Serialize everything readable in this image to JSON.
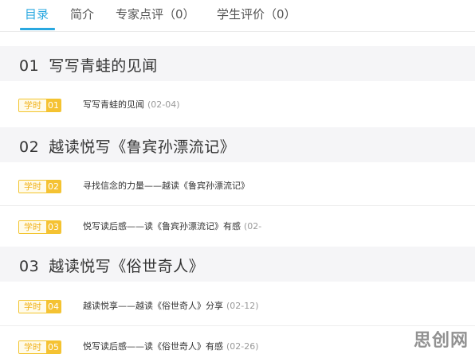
{
  "tabs": [
    {
      "label": "目录",
      "active": true
    },
    {
      "label": "简介"
    },
    {
      "label": "专家点评（0）"
    },
    {
      "label": "学生评价（0）"
    }
  ],
  "sections": [
    {
      "number": "01",
      "title": "写写青蛙的见闻",
      "lessons": [
        {
          "badge_label": "学时",
          "badge_num": "01",
          "title": "写写青蛙的见闻",
          "date": "(02-04)"
        }
      ]
    },
    {
      "number": "02",
      "title": "越读悦写《鲁宾孙漂流记》",
      "lessons": [
        {
          "badge_label": "学时",
          "badge_num": "02",
          "title": "寻找信念的力量——越读《鲁宾孙漂流记》",
          "date": ""
        },
        {
          "badge_label": "学时",
          "badge_num": "03",
          "title": "悦写读后感——读《鲁宾孙漂流记》有感",
          "date": "(02-"
        }
      ]
    },
    {
      "number": "03",
      "title": "越读悦写《俗世奇人》",
      "lessons": [
        {
          "badge_label": "学时",
          "badge_num": "04",
          "title": "越读悦享——越读《俗世奇人》分享",
          "date": "(02-12)"
        },
        {
          "badge_label": "学时",
          "badge_num": "05",
          "title": "悦写读后感——读《俗世奇人》有感",
          "date": "(02-26)"
        }
      ]
    }
  ],
  "watermark": "思创网",
  "colors": {
    "accent": "#2aa8e0",
    "badge": "#f5c233",
    "section_bg": "#f5f5f7"
  }
}
